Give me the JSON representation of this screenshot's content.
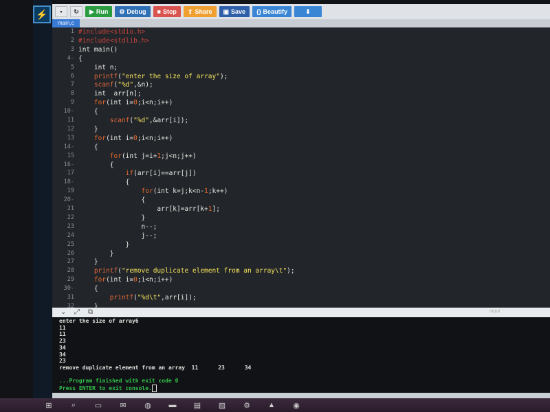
{
  "toolbar": {
    "buttons": [
      {
        "label": "",
        "icon": "file-icon"
      },
      {
        "label": "",
        "icon": "refresh-icon"
      },
      {
        "label": "Run",
        "icon": "play-icon"
      },
      {
        "label": "Debug",
        "icon": "debug-icon"
      },
      {
        "label": "Stop",
        "icon": "stop-icon"
      },
      {
        "label": "Share",
        "icon": "share-icon"
      },
      {
        "label": "Save",
        "icon": "save-icon"
      },
      {
        "label": "{} Beautify",
        "icon": ""
      },
      {
        "label": "",
        "icon": "download-icon"
      }
    ]
  },
  "tab": {
    "name": "main.c"
  },
  "code": [
    {
      "n": "1",
      "fold": "",
      "segs": [
        {
          "t": "#include<stdio.h>",
          "c": "pp"
        }
      ]
    },
    {
      "n": "2",
      "fold": "",
      "segs": [
        {
          "t": "#include<stdlib.h>",
          "c": "pp"
        }
      ]
    },
    {
      "n": "3",
      "fold": "",
      "segs": [
        {
          "t": "int main()",
          "c": ""
        }
      ]
    },
    {
      "n": "4",
      "fold": "-",
      "segs": [
        {
          "t": "{",
          "c": ""
        }
      ]
    },
    {
      "n": "5",
      "fold": "",
      "segs": [
        {
          "t": "    int n;",
          "c": ""
        }
      ]
    },
    {
      "n": "6",
      "fold": "",
      "segs": [
        {
          "t": "    ",
          "c": ""
        },
        {
          "t": "printf",
          "c": "fn"
        },
        {
          "t": "(",
          "c": ""
        },
        {
          "t": "\"enter the size of array\"",
          "c": "str"
        },
        {
          "t": ");",
          "c": ""
        }
      ]
    },
    {
      "n": "7",
      "fold": "",
      "segs": [
        {
          "t": "    ",
          "c": ""
        },
        {
          "t": "scanf",
          "c": "fn"
        },
        {
          "t": "(",
          "c": ""
        },
        {
          "t": "\"%d\"",
          "c": "str"
        },
        {
          "t": ",&n);",
          "c": ""
        }
      ]
    },
    {
      "n": "8",
      "fold": "",
      "segs": [
        {
          "t": "    int  arr[n];",
          "c": ""
        }
      ]
    },
    {
      "n": "9",
      "fold": "",
      "segs": [
        {
          "t": "    ",
          "c": ""
        },
        {
          "t": "for",
          "c": "kw"
        },
        {
          "t": "(int i=",
          "c": ""
        },
        {
          "t": "0",
          "c": "num"
        },
        {
          "t": ";i<n;i++)",
          "c": ""
        }
      ]
    },
    {
      "n": "10",
      "fold": "-",
      "segs": [
        {
          "t": "    {",
          "c": ""
        }
      ]
    },
    {
      "n": "11",
      "fold": "",
      "segs": [
        {
          "t": "        ",
          "c": ""
        },
        {
          "t": "scanf",
          "c": "fn"
        },
        {
          "t": "(",
          "c": ""
        },
        {
          "t": "\"%d\"",
          "c": "str"
        },
        {
          "t": ",&arr[i]);",
          "c": ""
        }
      ]
    },
    {
      "n": "12",
      "fold": "",
      "segs": [
        {
          "t": "    }",
          "c": ""
        }
      ]
    },
    {
      "n": "13",
      "fold": "",
      "segs": [
        {
          "t": "    ",
          "c": ""
        },
        {
          "t": "for",
          "c": "kw"
        },
        {
          "t": "(int i=",
          "c": ""
        },
        {
          "t": "0",
          "c": "num"
        },
        {
          "t": ";i<n;i++)",
          "c": ""
        }
      ]
    },
    {
      "n": "14",
      "fold": "-",
      "segs": [
        {
          "t": "    {",
          "c": ""
        }
      ]
    },
    {
      "n": "15",
      "fold": "",
      "segs": [
        {
          "t": "        ",
          "c": ""
        },
        {
          "t": "for",
          "c": "kw"
        },
        {
          "t": "(int j=i+",
          "c": ""
        },
        {
          "t": "1",
          "c": "num"
        },
        {
          "t": ";j<n;j++)",
          "c": ""
        }
      ]
    },
    {
      "n": "16",
      "fold": "-",
      "segs": [
        {
          "t": "        {",
          "c": ""
        }
      ]
    },
    {
      "n": "17",
      "fold": "",
      "segs": [
        {
          "t": "            ",
          "c": ""
        },
        {
          "t": "if",
          "c": "kw"
        },
        {
          "t": "(arr[i]==arr[j])",
          "c": ""
        }
      ]
    },
    {
      "n": "18",
      "fold": "-",
      "segs": [
        {
          "t": "            {",
          "c": ""
        }
      ]
    },
    {
      "n": "19",
      "fold": "",
      "segs": [
        {
          "t": "                ",
          "c": ""
        },
        {
          "t": "for",
          "c": "kw"
        },
        {
          "t": "(int k=j;k<n-",
          "c": ""
        },
        {
          "t": "1",
          "c": "num"
        },
        {
          "t": ";k++)",
          "c": ""
        }
      ]
    },
    {
      "n": "20",
      "fold": "-",
      "segs": [
        {
          "t": "                {",
          "c": ""
        }
      ]
    },
    {
      "n": "21",
      "fold": "",
      "segs": [
        {
          "t": "                    arr[k]=arr[k+",
          "c": ""
        },
        {
          "t": "1",
          "c": "num"
        },
        {
          "t": "];",
          "c": ""
        }
      ]
    },
    {
      "n": "22",
      "fold": "",
      "segs": [
        {
          "t": "                }",
          "c": ""
        }
      ]
    },
    {
      "n": "23",
      "fold": "",
      "segs": [
        {
          "t": "                n--;",
          "c": ""
        }
      ]
    },
    {
      "n": "24",
      "fold": "",
      "segs": [
        {
          "t": "                j--;",
          "c": ""
        }
      ]
    },
    {
      "n": "25",
      "fold": "",
      "segs": [
        {
          "t": "            }",
          "c": ""
        }
      ]
    },
    {
      "n": "26",
      "fold": "",
      "segs": [
        {
          "t": "        }",
          "c": ""
        }
      ]
    },
    {
      "n": "27",
      "fold": "",
      "segs": [
        {
          "t": "    }",
          "c": ""
        }
      ]
    },
    {
      "n": "28",
      "fold": "",
      "segs": [
        {
          "t": "    ",
          "c": ""
        },
        {
          "t": "printf",
          "c": "fn"
        },
        {
          "t": "(",
          "c": ""
        },
        {
          "t": "\"remove duplicate element from an array\\t\"",
          "c": "str"
        },
        {
          "t": ");",
          "c": ""
        }
      ]
    },
    {
      "n": "29",
      "fold": "",
      "segs": [
        {
          "t": "    ",
          "c": ""
        },
        {
          "t": "for",
          "c": "kw"
        },
        {
          "t": "(int i=",
          "c": ""
        },
        {
          "t": "0",
          "c": "num"
        },
        {
          "t": ";i<n;i++)",
          "c": ""
        }
      ]
    },
    {
      "n": "30",
      "fold": "-",
      "segs": [
        {
          "t": "    {",
          "c": ""
        }
      ]
    },
    {
      "n": "31",
      "fold": "",
      "segs": [
        {
          "t": "        ",
          "c": ""
        },
        {
          "t": "printf",
          "c": "fn"
        },
        {
          "t": "(",
          "c": ""
        },
        {
          "t": "\"%d\\t\"",
          "c": "str"
        },
        {
          "t": ",arr[i]);",
          "c": ""
        }
      ]
    },
    {
      "n": "32",
      "fold": "",
      "segs": [
        {
          "t": "    }",
          "c": ""
        }
      ]
    }
  ],
  "separator": {
    "input_label": "input"
  },
  "console": {
    "lines": [
      {
        "text": "enter the size of array6",
        "style": ""
      },
      {
        "text": "11",
        "style": ""
      },
      {
        "text": "11",
        "style": ""
      },
      {
        "text": "23",
        "style": ""
      },
      {
        "text": "34",
        "style": ""
      },
      {
        "text": "34",
        "style": ""
      },
      {
        "text": "23",
        "style": ""
      },
      {
        "text": "remove duplicate element from an array  11      23      34",
        "style": ""
      },
      {
        "text": "",
        "style": ""
      },
      {
        "text": "...Program finished with exit code 0",
        "style": "green"
      },
      {
        "text": "Press ENTER to exit console.",
        "style": "green"
      }
    ]
  },
  "taskbar": {
    "icons": [
      "windows-icon",
      "search-icon",
      "task-view-icon",
      "mail-icon",
      "browser-icon",
      "folder-icon",
      "store-icon",
      "photos-icon",
      "settings-icon",
      "app-icon",
      "chrome-icon"
    ]
  }
}
